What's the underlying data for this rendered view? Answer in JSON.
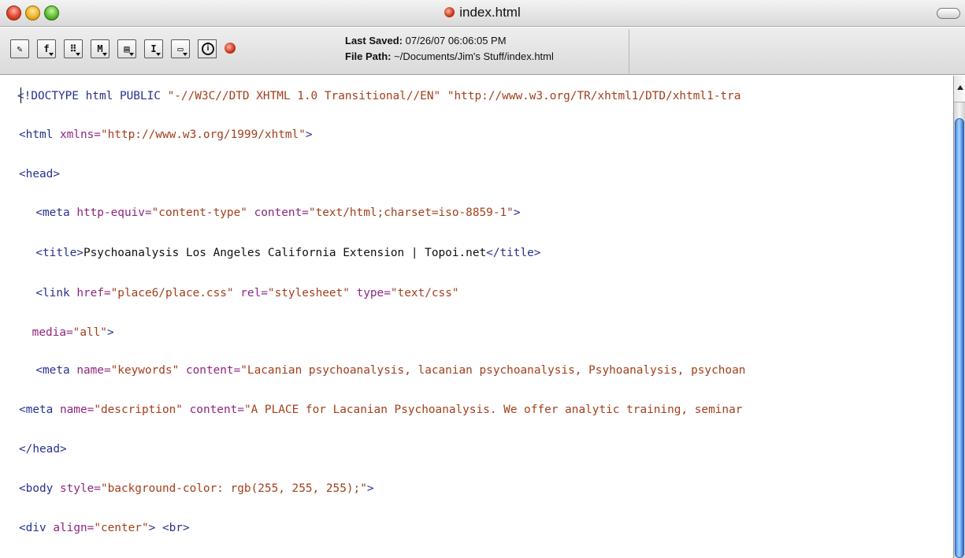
{
  "window": {
    "title": "index.html",
    "accent_colors": {
      "close": "#e0442c",
      "minimize": "#f0b428",
      "zoom": "#5fbd31"
    }
  },
  "toolbar": {
    "buttons": [
      {
        "icon": "pencil-icon",
        "glyph": "✎"
      },
      {
        "icon": "function-menu-icon",
        "glyph": "f"
      },
      {
        "icon": "markers-menu-icon",
        "glyph": "⠿"
      },
      {
        "icon": "m-menu-icon",
        "glyph": "M"
      },
      {
        "icon": "document-menu-icon",
        "glyph": "▤"
      },
      {
        "icon": "text-cursor-menu-icon",
        "glyph": "I"
      },
      {
        "icon": "window-menu-icon",
        "glyph": "▭"
      },
      {
        "icon": "info-icon",
        "glyph": "i"
      }
    ],
    "last_saved_label": "Last Saved:",
    "last_saved_value": "07/26/07 06:06:05 PM",
    "file_path_label": "File Path:",
    "file_path_value": "~/Documents/Jim's Stuff/index.html"
  },
  "editor": {
    "colors": {
      "tag": "#26328e",
      "attribute": "#8f2580",
      "value": "#a33f1c",
      "text": "#111111"
    },
    "lines": [
      [
        {
          "t": "tag",
          "s": "<!DOCTYPE html PUBLIC "
        },
        {
          "t": "val",
          "s": "\"-//W3C//DTD XHTML 1.0 Transitional//EN\""
        },
        {
          "t": "tag",
          "s": " "
        },
        {
          "t": "val",
          "s": "\"http://www.w3.org/TR/xhtml1/DTD/xhtml1-tra"
        }
      ],
      [
        {
          "t": "tag",
          "s": "<html "
        },
        {
          "t": "attr",
          "s": "xmlns="
        },
        {
          "t": "val",
          "s": "\"http://www.w3.org/1999/xhtml\""
        },
        {
          "t": "tag",
          "s": ">"
        }
      ],
      [
        {
          "t": "tag",
          "s": "<head>"
        }
      ],
      [
        {
          "t": "txt",
          "s": "  "
        },
        {
          "t": "tag",
          "s": "<meta "
        },
        {
          "t": "attr",
          "s": "http-equiv="
        },
        {
          "t": "val",
          "s": "\"content-type\""
        },
        {
          "t": "tag",
          "s": " "
        },
        {
          "t": "attr",
          "s": "content="
        },
        {
          "t": "val",
          "s": "\"text/html;charset=iso-8859-1\""
        },
        {
          "t": "tag",
          "s": ">"
        }
      ],
      [
        {
          "t": "txt",
          "s": "  "
        },
        {
          "t": "tag",
          "s": "<title>"
        },
        {
          "t": "txt",
          "s": "Psychoanalysis Los Angeles California Extension | Topoi.net"
        },
        {
          "t": "tag",
          "s": "</title>"
        }
      ],
      [
        {
          "t": "txt",
          "s": "  "
        },
        {
          "t": "tag",
          "s": "<link "
        },
        {
          "t": "attr",
          "s": "href="
        },
        {
          "t": "val",
          "s": "\"place6/place.css\""
        },
        {
          "t": "tag",
          "s": " "
        },
        {
          "t": "attr",
          "s": "rel="
        },
        {
          "t": "val",
          "s": "\"stylesheet\""
        },
        {
          "t": "tag",
          "s": " "
        },
        {
          "t": "attr",
          "s": "type="
        },
        {
          "t": "val",
          "s": "\"text/css\""
        }
      ],
      [
        {
          "t": "txt",
          "s": " "
        },
        {
          "t": "attr",
          "s": "media="
        },
        {
          "t": "val",
          "s": "\"all\""
        },
        {
          "t": "tag",
          "s": ">"
        }
      ],
      [
        {
          "t": "txt",
          "s": "  "
        },
        {
          "t": "tag",
          "s": "<meta "
        },
        {
          "t": "attr",
          "s": "name="
        },
        {
          "t": "val",
          "s": "\"keywords\""
        },
        {
          "t": "tag",
          "s": " "
        },
        {
          "t": "attr",
          "s": "content="
        },
        {
          "t": "val",
          "s": "\"Lacanian psychoanalysis, lacanian psychoanalysis, Psyhoanalysis, psychoan"
        }
      ],
      [
        {
          "t": "tag",
          "s": "<meta "
        },
        {
          "t": "attr",
          "s": "name="
        },
        {
          "t": "val",
          "s": "\"description\""
        },
        {
          "t": "tag",
          "s": " "
        },
        {
          "t": "attr",
          "s": "content="
        },
        {
          "t": "val",
          "s": "\"A PLACE for Lacanian Psychoanalysis. We offer analytic training, seminar"
        }
      ],
      [
        {
          "t": "tag",
          "s": "</head>"
        }
      ],
      [
        {
          "t": "tag",
          "s": "<body "
        },
        {
          "t": "attr",
          "s": "style="
        },
        {
          "t": "val",
          "s": "\"background-color: rgb(255, 255, 255);\""
        },
        {
          "t": "tag",
          "s": ">"
        }
      ],
      [
        {
          "t": "tag",
          "s": "<div "
        },
        {
          "t": "attr",
          "s": "align="
        },
        {
          "t": "val",
          "s": "\"center\""
        },
        {
          "t": "tag",
          "s": "> <br>"
        }
      ]
    ]
  }
}
